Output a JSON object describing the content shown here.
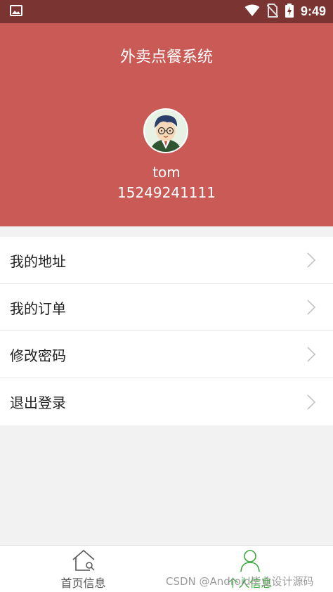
{
  "status_bar": {
    "time": "9:49"
  },
  "header": {
    "title": "外卖点餐系统",
    "username": "tom",
    "phone": "15249241111"
  },
  "menu": {
    "items": [
      {
        "label": "我的地址"
      },
      {
        "label": "我的订单"
      },
      {
        "label": "修改密码"
      },
      {
        "label": "退出登录"
      }
    ]
  },
  "bottom_nav": {
    "home_label": "首页信息",
    "profile_label": "个人信息"
  },
  "watermark": "CSDN @Android毕业设计源码",
  "colors": {
    "status_bar": "#7a3431",
    "header": "#c95a55",
    "active_tab": "#3aa83a"
  }
}
